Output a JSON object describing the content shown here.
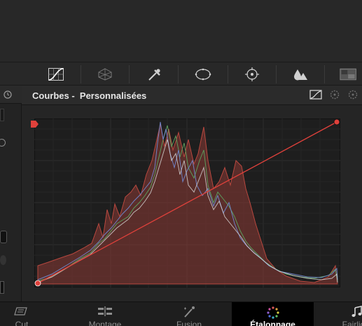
{
  "panel": {
    "title": "Courbes -  Personnalisées"
  },
  "toolbar": {
    "tools": [
      "curves-icon",
      "warper-icon",
      "qualifier-icon",
      "window-icon",
      "tracker-icon",
      "blur-icon",
      "key-icon"
    ]
  },
  "pages": [
    {
      "label": "Cut",
      "icon": "cut-page-icon",
      "active": false
    },
    {
      "label": "Montage",
      "icon": "edit-page-icon",
      "active": false
    },
    {
      "label": "Fusion",
      "icon": "fusion-page-icon",
      "active": false
    },
    {
      "label": "Étalonnage",
      "icon": "color-page-icon",
      "active": true
    },
    {
      "label": "Fairlight",
      "icon": "fairlight-page-icon",
      "active": false
    }
  ],
  "colors": {
    "accent_curve": "#e0413b",
    "active_tab_bg": "#000000",
    "histogram_red": "#b8483f",
    "histogram_green": "#5c9c5c",
    "histogram_blue": "#6f82c4"
  }
}
